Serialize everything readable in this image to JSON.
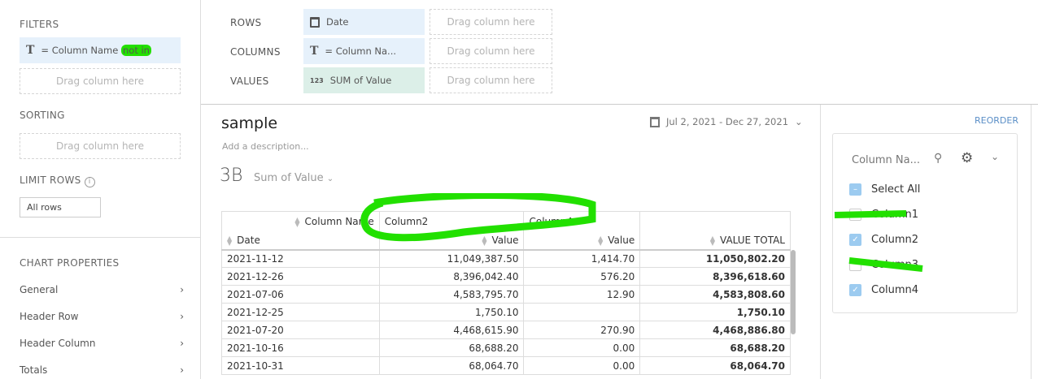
{
  "left": {
    "filters_label": "FILTERS",
    "filter_pill": "= Column Name",
    "filter_op": "not in",
    "drag": "Drag column here",
    "sorting_label": "SORTING",
    "limit_label": "LIMIT ROWS",
    "limit_value": "All rows",
    "chart_props_label": "CHART PROPERTIES",
    "props": [
      "General",
      "Header Row",
      "Header Column",
      "Totals"
    ]
  },
  "top": {
    "rows_label": "ROWS",
    "columns_label": "COLUMNS",
    "values_label": "VALUES",
    "rows_pill": "Date",
    "columns_pill": "= Column Na...",
    "values_pill": "SUM of Value",
    "values_icon": "123",
    "drag": "Drag column here"
  },
  "main": {
    "title": "sample",
    "description": "Add a description...",
    "metric_value": "3B",
    "metric_label": "Sum of Value",
    "date_range": "Jul 2, 2021 - Dec 27, 2021"
  },
  "table": {
    "pivot_label": "Column Name",
    "col_groups": [
      "Column2",
      "Column4"
    ],
    "headers": [
      "Date",
      "Value",
      "Value",
      "VALUE TOTAL"
    ],
    "rows": [
      [
        "2021-11-12",
        "11,049,387.50",
        "1,414.70",
        "11,050,802.20"
      ],
      [
        "2021-12-26",
        "8,396,042.40",
        "576.20",
        "8,396,618.60"
      ],
      [
        "2021-07-06",
        "4,583,795.70",
        "12.90",
        "4,583,808.60"
      ],
      [
        "2021-12-25",
        "1,750.10",
        "",
        "1,750.10"
      ],
      [
        "2021-07-20",
        "4,468,615.90",
        "270.90",
        "4,468,886.80"
      ],
      [
        "2021-10-16",
        "68,688.20",
        "0.00",
        "68,688.20"
      ],
      [
        "2021-10-31",
        "68,064.70",
        "0.00",
        "68,064.70"
      ]
    ]
  },
  "right": {
    "reorder": "REORDER",
    "filter_title": "Column Na...",
    "items": [
      {
        "label": "Select All",
        "state": "partial"
      },
      {
        "label": "Column1",
        "state": "off"
      },
      {
        "label": "Column2",
        "state": "on"
      },
      {
        "label": "Column3",
        "state": "off"
      },
      {
        "label": "Column4",
        "state": "on"
      }
    ]
  },
  "colors": {
    "highlight": "#22e000",
    "accent": "#5b8fc7"
  }
}
